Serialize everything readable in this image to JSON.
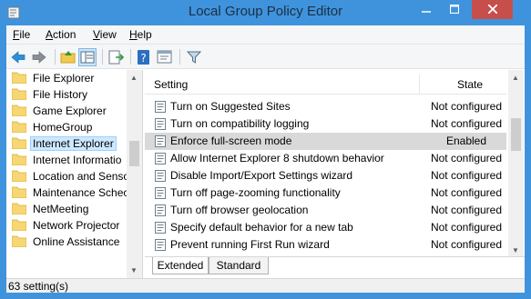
{
  "window": {
    "title": "Local Group Policy Editor"
  },
  "menu": [
    {
      "label": "File",
      "accel": "F",
      "rest": "ile"
    },
    {
      "label": "Action",
      "accel": "A",
      "rest": "ction"
    },
    {
      "label": "View",
      "accel": "V",
      "rest": "iew"
    },
    {
      "label": "Help",
      "accel": "H",
      "rest": "elp"
    }
  ],
  "toolbar": [
    "back-icon",
    "forward-icon",
    "up-folder-icon",
    "show-hide-tree-icon",
    "export-list-icon",
    "help-icon",
    "properties-icon",
    "filter-icon"
  ],
  "tree": {
    "items": [
      {
        "label": "File Explorer",
        "selected": false
      },
      {
        "label": "File History",
        "selected": false
      },
      {
        "label": "Game Explorer",
        "selected": false
      },
      {
        "label": "HomeGroup",
        "selected": false
      },
      {
        "label": "Internet Explorer",
        "selected": true
      },
      {
        "label": "Internet Informatio",
        "selected": false
      },
      {
        "label": "Location and Senso",
        "selected": false
      },
      {
        "label": "Maintenance Schec",
        "selected": false
      },
      {
        "label": "NetMeeting",
        "selected": false
      },
      {
        "label": "Network Projector",
        "selected": false
      },
      {
        "label": "Online Assistance",
        "selected": false
      }
    ]
  },
  "list": {
    "columns": {
      "setting": "Setting",
      "state": "State"
    },
    "rows": [
      {
        "name": "Turn on Suggested Sites",
        "state": "Not configured",
        "selected": false
      },
      {
        "name": "Turn on compatibility logging",
        "state": "Not configured",
        "selected": false
      },
      {
        "name": "Enforce full-screen mode",
        "state": "Enabled",
        "selected": true
      },
      {
        "name": "Allow Internet Explorer 8 shutdown behavior",
        "state": "Not configured",
        "selected": false
      },
      {
        "name": "Disable Import/Export Settings wizard",
        "state": "Not configured",
        "selected": false
      },
      {
        "name": "Turn off page-zooming functionality",
        "state": "Not configured",
        "selected": false
      },
      {
        "name": "Turn off browser geolocation",
        "state": "Not configured",
        "selected": false
      },
      {
        "name": "Specify default behavior for a new tab",
        "state": "Not configured",
        "selected": false
      },
      {
        "name": "Prevent running First Run wizard",
        "state": "Not configured",
        "selected": false
      }
    ]
  },
  "tabs": [
    {
      "label": "Extended",
      "active": false
    },
    {
      "label": "Standard",
      "active": true
    }
  ],
  "status": {
    "text": "63 setting(s)"
  },
  "colors": {
    "titlebar": "#3f93dc",
    "close": "#c74f4b",
    "selection": "#cde8ff",
    "row_selected": "#d9d9d9"
  }
}
